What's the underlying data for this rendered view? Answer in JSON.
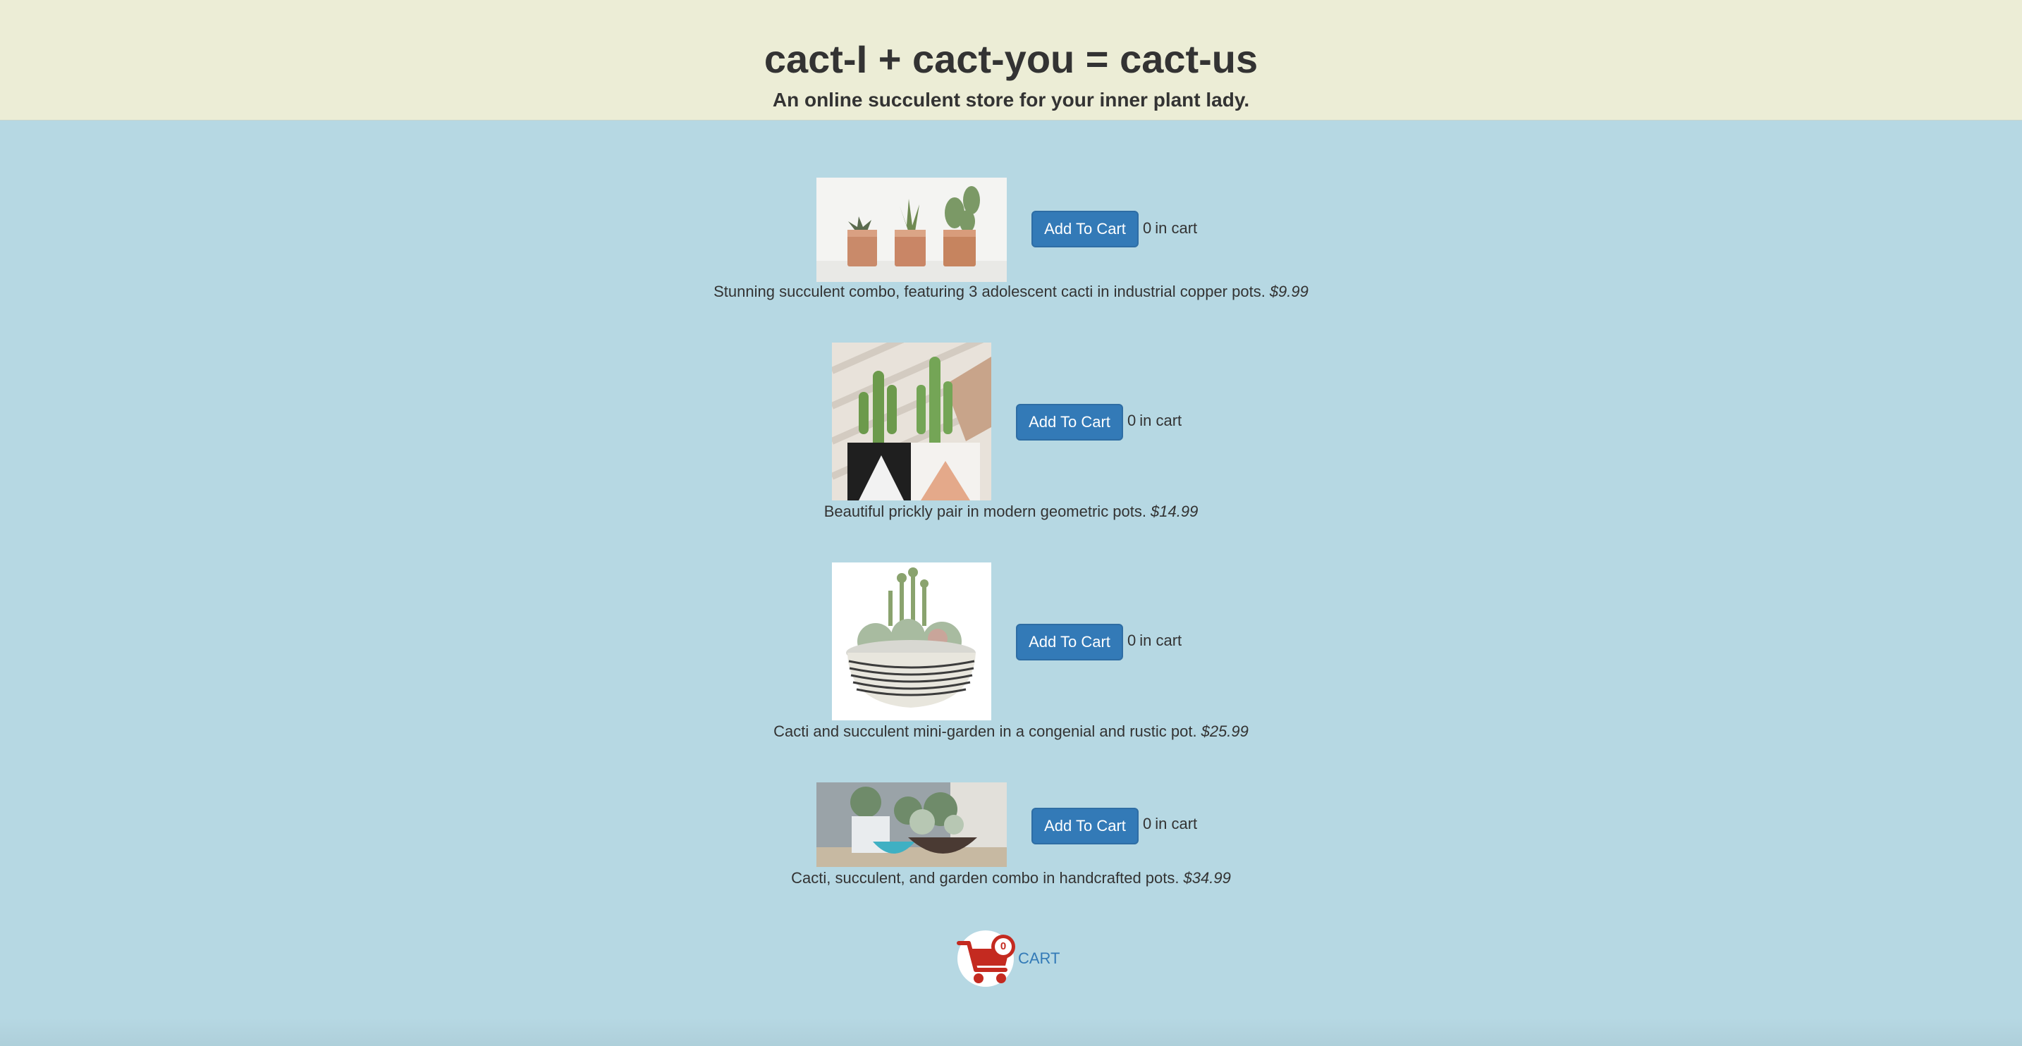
{
  "header": {
    "title": "cact-I + cact-you = cact-us",
    "subtitle": "An online succulent store for your inner plant lady."
  },
  "products": [
    {
      "description": "Stunning succulent combo, featuring 3 adolescent cacti in industrial copper pots.",
      "price": "$9.99",
      "button_label": "Add To Cart",
      "cart_count": "0",
      "cart_suffix": "in cart"
    },
    {
      "description": "Beautiful prickly pair in modern geometric pots.",
      "price": "$14.99",
      "button_label": "Add To Cart",
      "cart_count": "0",
      "cart_suffix": "in cart"
    },
    {
      "description": "Cacti and succulent mini-garden in a congenial and rustic pot.",
      "price": "$25.99",
      "button_label": "Add To Cart",
      "cart_count": "0",
      "cart_suffix": "in cart"
    },
    {
      "description": "Cacti, succulent, and garden combo in handcrafted pots.",
      "price": "$34.99",
      "button_label": "Add To Cart",
      "cart_count": "0",
      "cart_suffix": "in cart"
    }
  ],
  "cart": {
    "icon": "shopping-cart-icon",
    "count": "0",
    "label": "CART"
  },
  "colors": {
    "header_bg": "#ecedd6",
    "page_bg": "#b6d8e3",
    "button_bg": "#337ab7",
    "cart_red": "#c42a20"
  }
}
